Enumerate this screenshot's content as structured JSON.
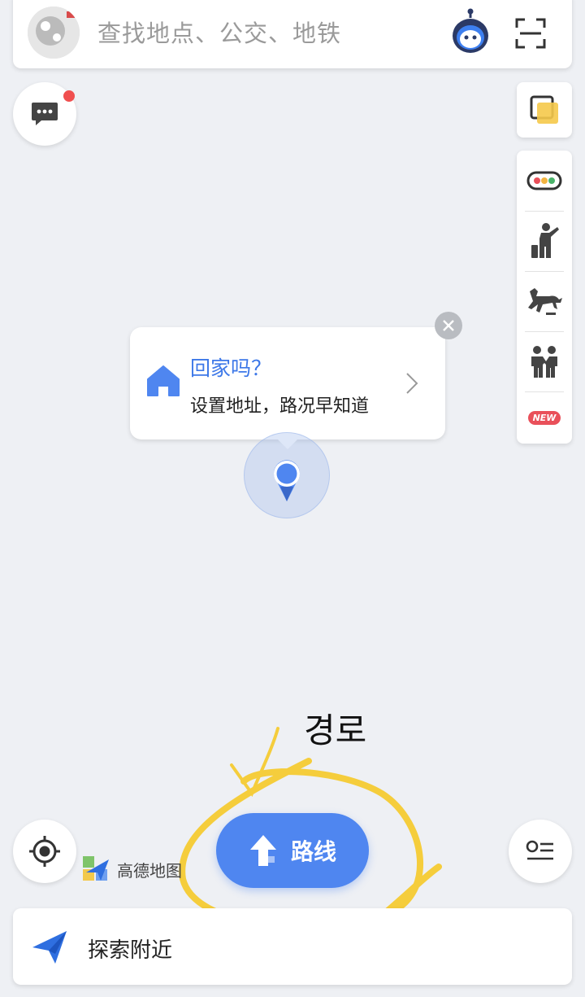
{
  "search": {
    "placeholder": "查找地点、公交、地铁"
  },
  "home_tip": {
    "title": "回家吗？",
    "subtitle": "设置地址，路况早知道"
  },
  "right_tools": {
    "new_badge": "NEW"
  },
  "bottom": {
    "logo_text": "高德地图",
    "route_label": "路线",
    "explore_label": "探索附近"
  },
  "annotation": {
    "text": "경로",
    "color": "#f5cd3c"
  },
  "colors": {
    "accent": "#4f86f0",
    "notification": "#f04f4f"
  }
}
